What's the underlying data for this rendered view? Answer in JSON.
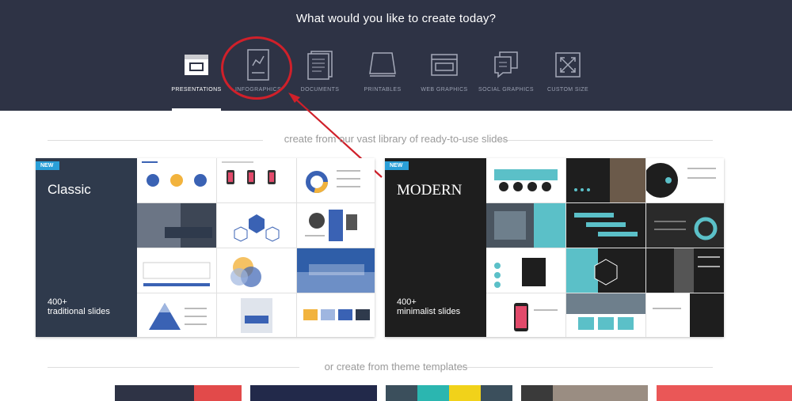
{
  "header": {
    "title": "What would you like to create today?"
  },
  "nav": {
    "items": [
      {
        "label": "PRESENTATIONS",
        "icon": "presentation-icon"
      },
      {
        "label": "INFOGRAPHICS",
        "icon": "infographic-icon"
      },
      {
        "label": "DOCUMENTS",
        "icon": "document-icon"
      },
      {
        "label": "PRINTABLES",
        "icon": "printables-icon"
      },
      {
        "label": "WEB GRAPHICS",
        "icon": "web-graphics-icon"
      },
      {
        "label": "SOCIAL GRAPHICS",
        "icon": "social-graphics-icon"
      },
      {
        "label": "CUSTOM SIZE",
        "icon": "custom-size-icon"
      }
    ]
  },
  "library": {
    "heading": "create from our vast library of ready-to-use slides"
  },
  "cards": {
    "classic": {
      "badge": "NEW",
      "title": "Classic",
      "count": "400+",
      "subtitle": "traditional slides"
    },
    "modern": {
      "badge": "NEW",
      "title": "MODERN",
      "count": "400+",
      "subtitle": "minimalist slides"
    }
  },
  "themes": {
    "heading": "or create from theme templates"
  },
  "colors": {
    "topbar": "#2e3345",
    "accent": "#2a9fd8",
    "highlight": "#d0202a",
    "classic_panel": "#2f3a4c",
    "modern_panel": "#1e1e1e"
  }
}
